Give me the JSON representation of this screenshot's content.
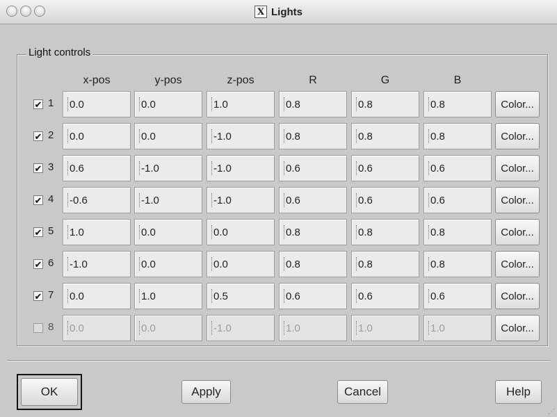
{
  "window": {
    "title": "Lights",
    "title_icon": "X"
  },
  "group": {
    "label": "Light controls"
  },
  "columns": [
    "x-pos",
    "y-pos",
    "z-pos",
    "R",
    "G",
    "B"
  ],
  "lights": [
    {
      "num": "1",
      "checked": true,
      "values": [
        "0.0",
        "0.0",
        "1.0",
        "0.8",
        "0.8",
        "0.8"
      ],
      "color_label": "Color..."
    },
    {
      "num": "2",
      "checked": true,
      "values": [
        "0.0",
        "0.0",
        "-1.0",
        "0.8",
        "0.8",
        "0.8"
      ],
      "color_label": "Color..."
    },
    {
      "num": "3",
      "checked": true,
      "values": [
        "0.6",
        "-1.0",
        "-1.0",
        "0.6",
        "0.6",
        "0.6"
      ],
      "color_label": "Color..."
    },
    {
      "num": "4",
      "checked": true,
      "values": [
        "-0.6",
        "-1.0",
        "-1.0",
        "0.6",
        "0.6",
        "0.6"
      ],
      "color_label": "Color..."
    },
    {
      "num": "5",
      "checked": true,
      "values": [
        "1.0",
        "0.0",
        "0.0",
        "0.8",
        "0.8",
        "0.8"
      ],
      "color_label": "Color..."
    },
    {
      "num": "6",
      "checked": true,
      "values": [
        "-1.0",
        "0.0",
        "0.0",
        "0.8",
        "0.8",
        "0.8"
      ],
      "color_label": "Color..."
    },
    {
      "num": "7",
      "checked": true,
      "values": [
        "0.0",
        "1.0",
        "0.5",
        "0.6",
        "0.6",
        "0.6"
      ],
      "color_label": "Color..."
    },
    {
      "num": "8",
      "checked": false,
      "values": [
        "0.0",
        "0.0",
        "-1.0",
        "1.0",
        "1.0",
        "1.0"
      ],
      "color_label": "Color..."
    }
  ],
  "buttons": {
    "ok": "OK",
    "apply": "Apply",
    "cancel": "Cancel",
    "help": "Help"
  },
  "icons": {
    "checkmark": "✔",
    "resize_grip": "⋰"
  }
}
